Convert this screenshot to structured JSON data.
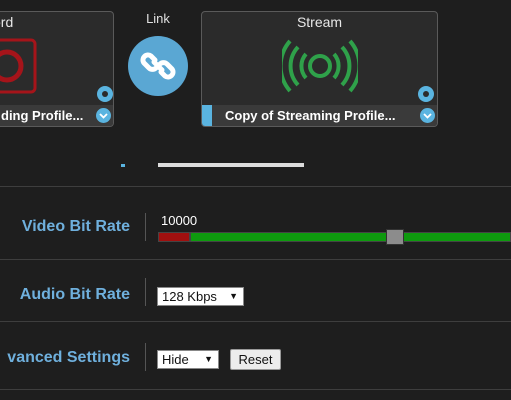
{
  "cards": {
    "record": {
      "title": "ord",
      "profile": "ding Profile..."
    },
    "link": {
      "title": "Link"
    },
    "stream": {
      "title": "Stream",
      "profile": "Copy of Streaming Profile..."
    }
  },
  "settings": {
    "video_bit_rate": {
      "label": "Video Bit Rate",
      "value": "10000",
      "slider_fraction": 0.67
    },
    "audio_bit_rate": {
      "label": "Audio Bit Rate",
      "selected": "128 Kbps"
    },
    "advanced": {
      "label": "vanced Settings",
      "selected": "Hide",
      "reset_label": "Reset"
    }
  },
  "colors": {
    "accent": "#5ab4e0",
    "label": "#6fb0dd",
    "slider_red": "#a0100f",
    "slider_green": "#0e9a0e",
    "stream_icon": "#2fa14a"
  },
  "icons": {
    "record": "record-icon",
    "link": "link-icon",
    "stream": "broadcast-icon",
    "settings": "gear-icon",
    "dropdown": "chevron-down-icon"
  }
}
